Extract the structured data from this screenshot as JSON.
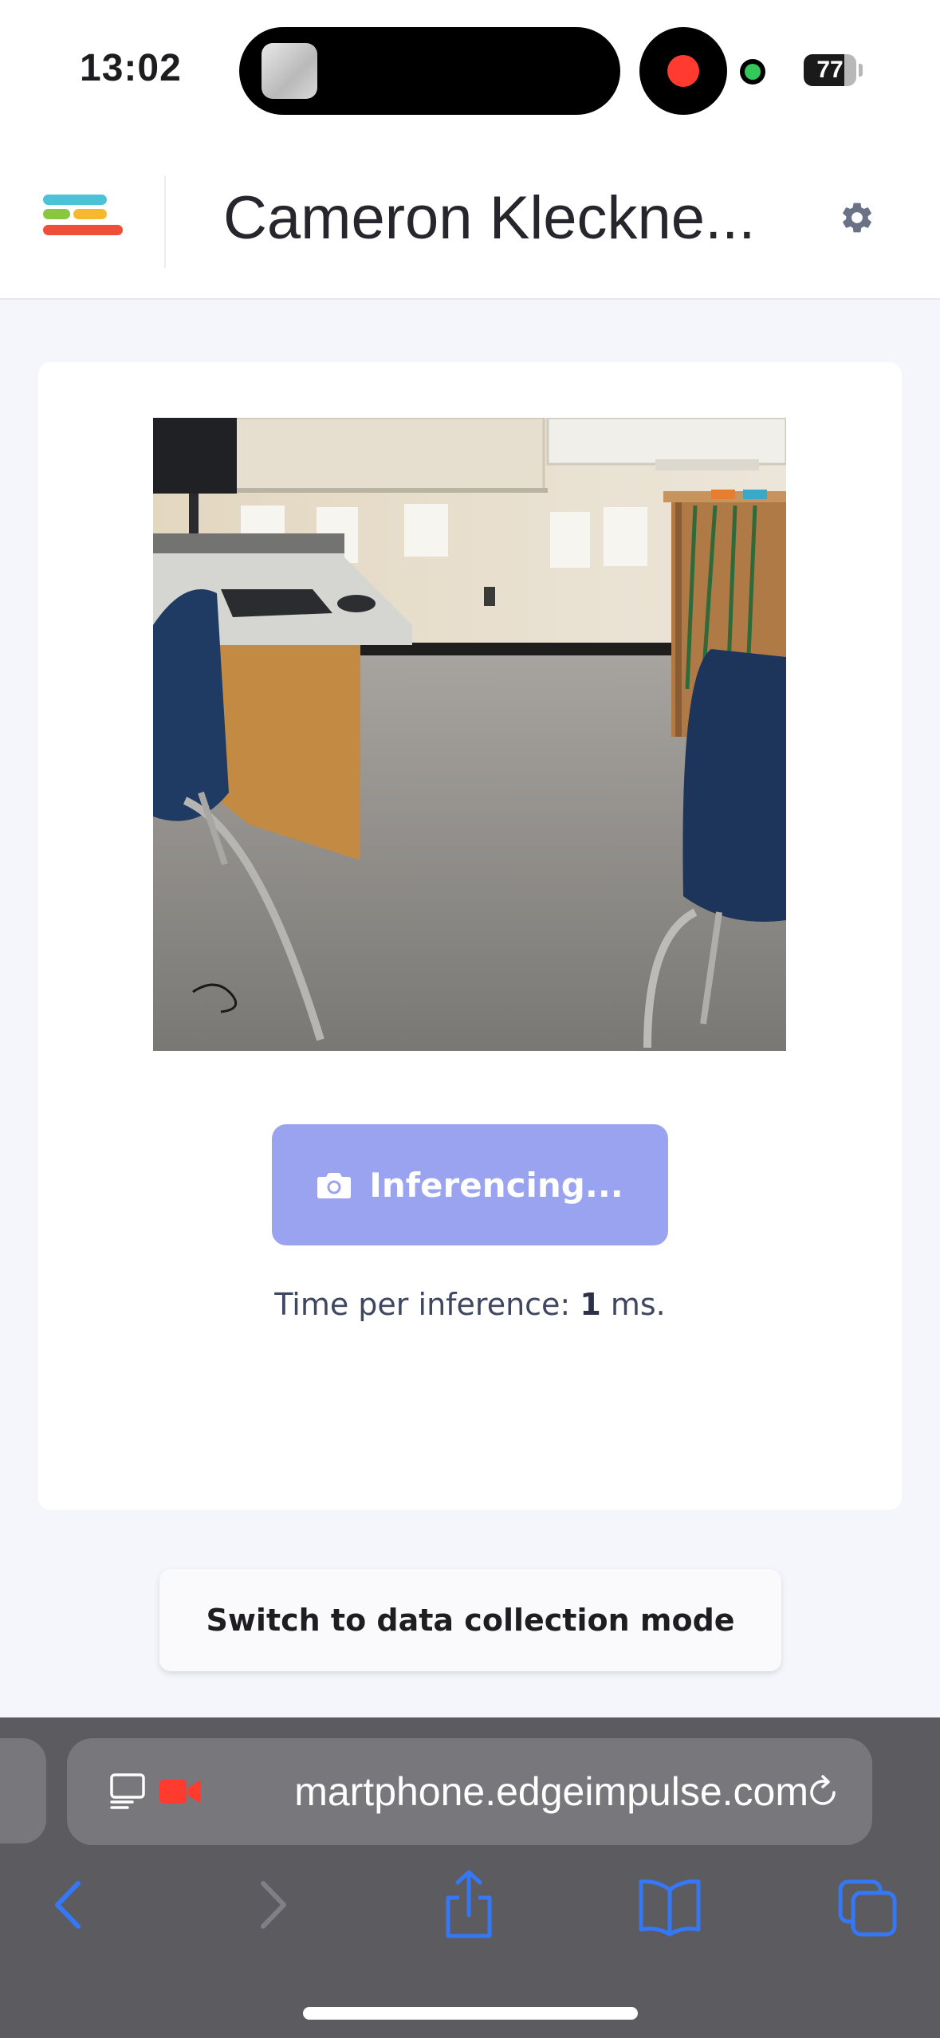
{
  "status_bar": {
    "time": "13:02",
    "battery_percent": 77,
    "battery_label": "77"
  },
  "header": {
    "project_title": "Cameron Kleckne...",
    "logo_colors": [
      "#4cc2d7",
      "#8bc63f",
      "#f5b82e",
      "#ef4e3b"
    ]
  },
  "main": {
    "inference_button_label": "Inferencing...",
    "timing_prefix": "Time per inference: ",
    "timing_value": "1",
    "timing_suffix": " ms.",
    "accent_color": "#9aa3ef"
  },
  "mode_switch": {
    "label": "Switch to data collection mode"
  },
  "browser": {
    "url": "martphone.edgeimpulse.com",
    "icons": [
      "reader-icon",
      "camera-recording-icon",
      "reload-icon",
      "back-icon",
      "forward-icon",
      "share-icon",
      "bookmarks-icon",
      "tabs-icon"
    ],
    "icon_color": "#3478f6"
  }
}
